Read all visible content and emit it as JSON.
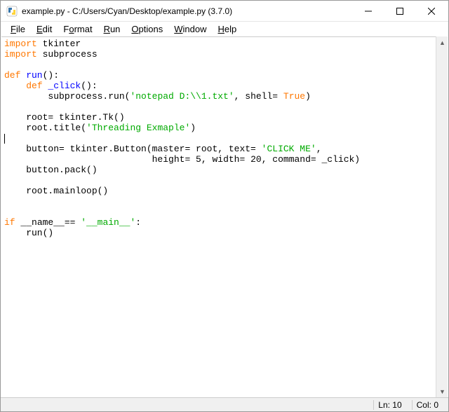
{
  "window": {
    "title": "example.py - C:/Users/Cyan/Desktop/example.py (3.7.0)"
  },
  "menu": {
    "file": "File",
    "edit": "Edit",
    "format": "Format",
    "run": "Run",
    "options": "Options",
    "window": "Window",
    "help": "Help"
  },
  "code": {
    "l1_import": "import",
    "l1_mod": " tkinter",
    "l2_import": "import",
    "l2_mod": " subprocess",
    "l4_def": "def",
    "l4_name": " run",
    "l4_rest": "():",
    "l5_indent": "    ",
    "l5_def": "def",
    "l5_name": " _click",
    "l5_rest": "():",
    "l6_indent": "        subprocess.run(",
    "l6_str": "'notepad D:\\\\1.txt'",
    "l6_mid": ", shell= ",
    "l6_true": "True",
    "l6_end": ")",
    "l8": "    root= tkinter.Tk()",
    "l9a": "    root.title(",
    "l9_str": "'Threading Exmaple'",
    "l9b": ")",
    "l11a": "    button= tkinter.Button(master= root, text= ",
    "l11_str": "'CLICK ME'",
    "l11b": ",",
    "l12a": "                           height= ",
    "l12_n1": "5",
    "l12b": ", width= ",
    "l12_n2": "20",
    "l12c": ", command= _click)",
    "l13": "    button.pack()",
    "l15": "    root.mainloop()",
    "l18_if": "if",
    "l18_a": " __name__== ",
    "l18_str": "'__main__'",
    "l18_b": ":",
    "l19": "    run()"
  },
  "status": {
    "ln": "Ln: 10",
    "col": "Col: 0"
  }
}
